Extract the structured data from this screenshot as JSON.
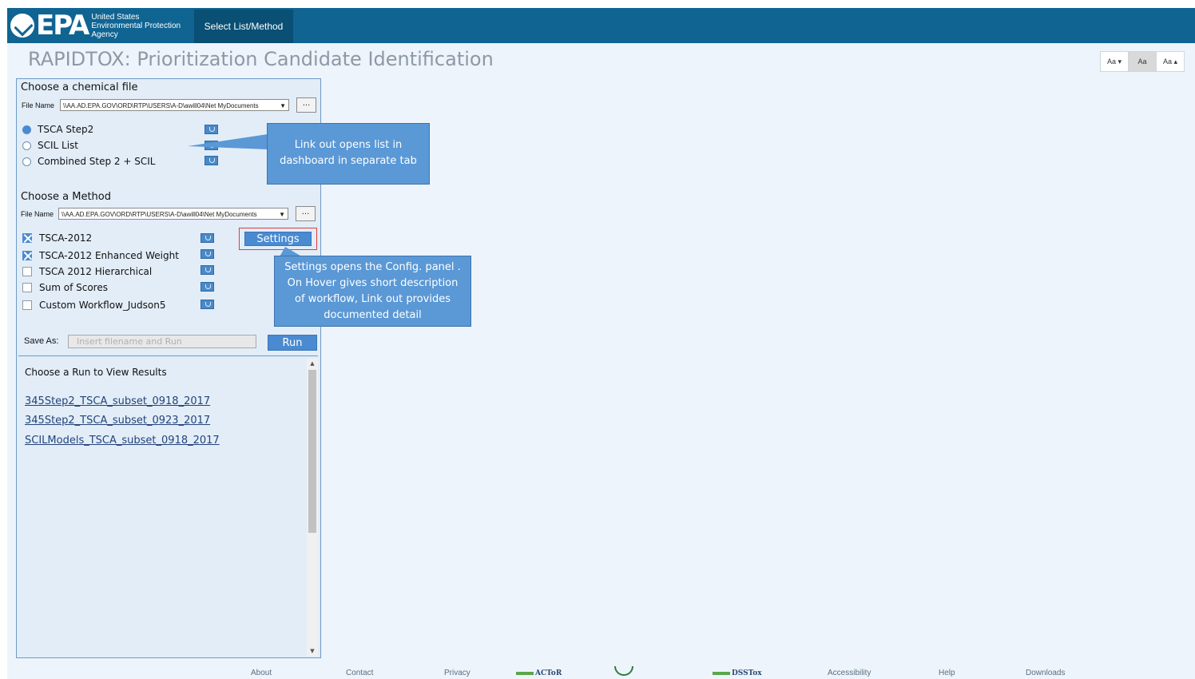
{
  "header": {
    "logo_text": "EPA",
    "agency_lines": [
      "United States",
      "Environmental Protection",
      "Agency"
    ],
    "nav_tab": "Select List/Method"
  },
  "title": "RAPIDTOX: Prioritization Candidate Identification",
  "font_controls": [
    "Aa ▾",
    "Aa",
    "Aa ▴"
  ],
  "chemical_file": {
    "heading": "Choose a chemical file",
    "file_label": "File Name",
    "file_path": "\\\\AA.AD.EPA.GOV\\ORD\\RTP\\USERS\\A-D\\awill04\\Net MyDocuments",
    "browse_label": "...",
    "options": [
      {
        "label": "TSCA Step2",
        "selected": true
      },
      {
        "label": "SCIL List",
        "selected": false
      },
      {
        "label": "Combined Step 2 + SCIL",
        "selected": false
      }
    ]
  },
  "method": {
    "heading": "Choose a Method",
    "file_label": "File Name",
    "file_path": "\\\\AA.AD.EPA.GOV\\ORD\\RTP\\USERS\\A-D\\awill04\\Net MyDocuments",
    "browse_label": "...",
    "settings_label": "Settings",
    "options": [
      {
        "label": "TSCA-2012",
        "checked": true
      },
      {
        "label": "TSCA-2012 Enhanced Weight",
        "checked": true
      },
      {
        "label": "TSCA 2012 Hierarchical",
        "checked": false
      },
      {
        "label": "Sum of Scores",
        "checked": false
      },
      {
        "label": "Custom Workflow_Judson5",
        "checked": false
      }
    ]
  },
  "save": {
    "label": "Save As:",
    "placeholder": "Insert filename and Run",
    "run_label": "Run"
  },
  "results": {
    "heading": "Choose a Run to View Results",
    "runs": [
      "345Step2_TSCA_subset_0918_2017",
      "345Step2_TSCA_subset_0923_2017",
      "SCILModels_TSCA_subset_0918_2017"
    ]
  },
  "callouts": {
    "link_out": "Link out opens list in dashboard in separate tab",
    "settings": "Settings opens the Config. panel . On Hover  gives short description of workflow, Link out provides documented detail"
  },
  "footer": {
    "links": [
      "About",
      "Contact",
      "Privacy",
      "Accessibility",
      "Help",
      "Downloads"
    ],
    "brands": [
      "ACToR",
      "DSSTox"
    ]
  },
  "colors": {
    "topbar": "#0f6492",
    "accent": "#4a8ad0",
    "callout": "#5a98d6",
    "highlight": "#e03c3c"
  }
}
